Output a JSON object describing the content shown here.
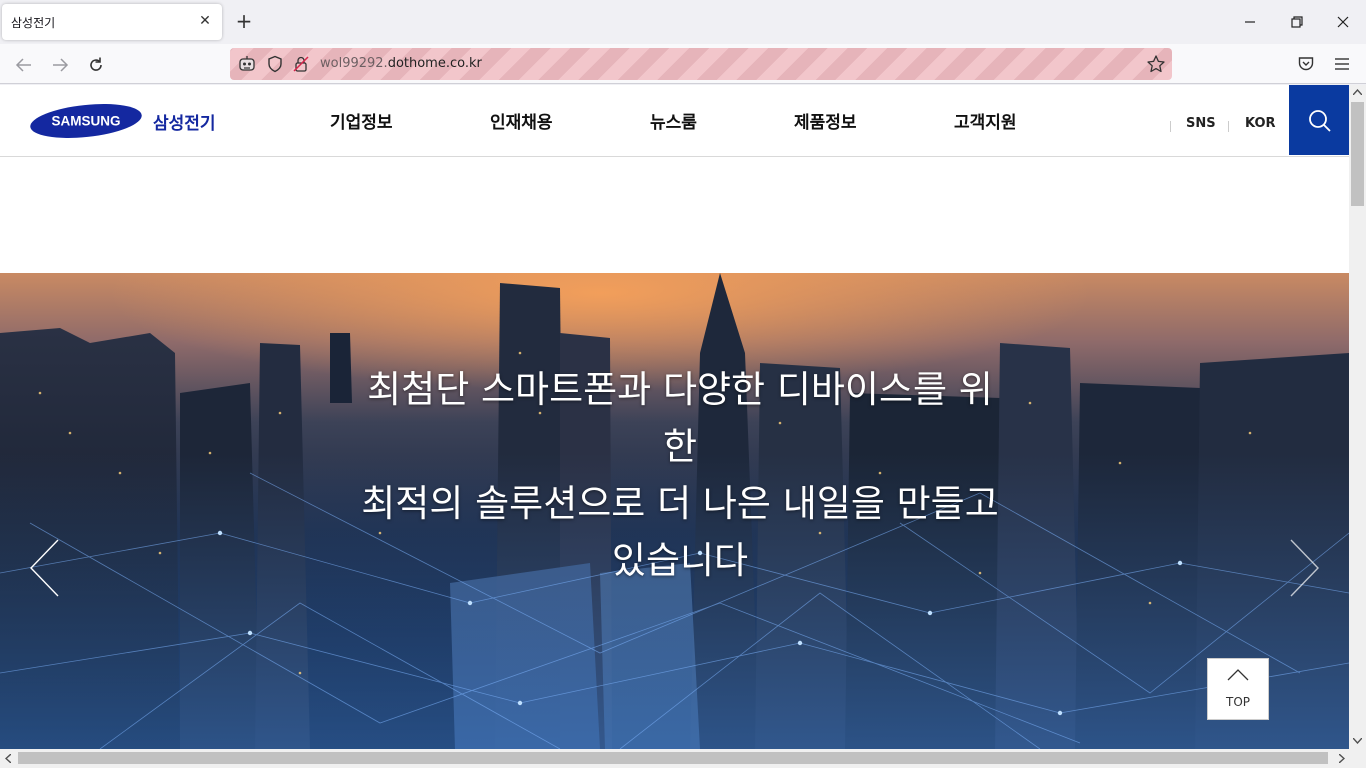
{
  "browser": {
    "tab_title": "삼성전기",
    "url_host": "wol99292.",
    "url_domain": "dothome.co.kr"
  },
  "site": {
    "logo_text": "SAMSUNG",
    "logo_kr": "삼성전기",
    "nav": [
      "기업정보",
      "인재채용",
      "뉴스룸",
      "제품정보",
      "고객지원"
    ],
    "util": {
      "sns": "SNS",
      "lang": "KOR"
    },
    "brand_color": "#1428a0"
  },
  "hero": {
    "line1": "최첨단 스마트폰과 다양한 디바이스를 위",
    "line2": "한",
    "line3": "최적의 솔루션으로 더 나은 내일을 만들고",
    "line4": "있습니다"
  },
  "top_button": {
    "label": "TOP"
  }
}
